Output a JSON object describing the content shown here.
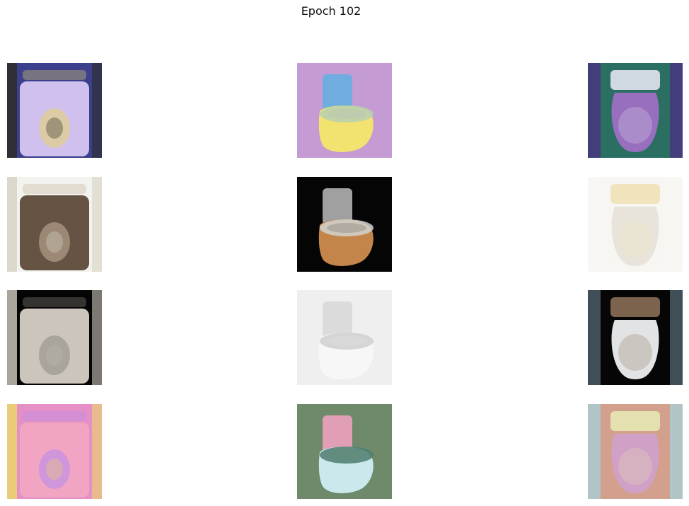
{
  "figure": {
    "title": "Epoch 102"
  },
  "grid": {
    "rows": 4,
    "cols": 3,
    "tiles": [
      {
        "row": 0,
        "col": 0,
        "subject": "toilet-top-view",
        "palette": {
          "bg": "#3b3f8c",
          "body": "#d8c7f2",
          "accent": "#e8d36a",
          "edge": "#2e2e2e"
        }
      },
      {
        "row": 0,
        "col": 1,
        "subject": "toilet-side-view",
        "palette": {
          "bg": "#c49bd2",
          "body": "#f3e36e",
          "accent": "#6aaee0",
          "edge": "#b7d0b0"
        }
      },
      {
        "row": 0,
        "col": 2,
        "subject": "toilet-front-view",
        "palette": {
          "bg": "#2a6f62",
          "body": "#9c6fc2",
          "accent": "#e2e4ef",
          "edge": "#4b2a86"
        }
      },
      {
        "row": 1,
        "col": 0,
        "subject": "toilet-top-view",
        "palette": {
          "bg": "#f2f3ee",
          "body": "#5e4a3a",
          "accent": "#c9b59c",
          "edge": "#d8d6c8"
        }
      },
      {
        "row": 1,
        "col": 1,
        "subject": "toilet-side-view",
        "palette": {
          "bg": "#050505",
          "body": "#c7884a",
          "accent": "#a9a9a9",
          "edge": "#d2d4d0"
        }
      },
      {
        "row": 1,
        "col": 2,
        "subject": "toilet-front-view",
        "palette": {
          "bg": "#f7f6f2",
          "body": "#e7e3da",
          "accent": "#efe2b6",
          "edge": "#faf8f4"
        }
      },
      {
        "row": 2,
        "col": 0,
        "subject": "toilet-top-view",
        "palette": {
          "bg": "#050505",
          "body": "#d6d0c6",
          "accent": "#8f8a7f",
          "edge": "#bdb7ad"
        }
      },
      {
        "row": 2,
        "col": 1,
        "subject": "toilet-side-view",
        "palette": {
          "bg": "#efefef",
          "body": "#f7f7f7",
          "accent": "#d9d9d9",
          "edge": "#cfcfcf"
        }
      },
      {
        "row": 2,
        "col": 2,
        "subject": "toilet-front-view",
        "palette": {
          "bg": "#060606",
          "body": "#e8eaec",
          "accent": "#8a6e55",
          "edge": "#5a6f7a"
        }
      },
      {
        "row": 3,
        "col": 0,
        "subject": "toilet-top-view",
        "palette": {
          "bg": "#e48fc5",
          "body": "#f2a7c3",
          "accent": "#b58bf0",
          "edge": "#ead26f"
        }
      },
      {
        "row": 3,
        "col": 1,
        "subject": "toilet-side-view",
        "palette": {
          "bg": "#6e8a6a",
          "body": "#cdebef",
          "accent": "#e6a0b8",
          "edge": "#4f7b6f"
        }
      },
      {
        "row": 3,
        "col": 2,
        "subject": "toilet-front-view",
        "palette": {
          "bg": "#d3a08e",
          "body": "#d0a0c8",
          "accent": "#e7e7b3",
          "edge": "#a3d4e0"
        }
      }
    ]
  }
}
